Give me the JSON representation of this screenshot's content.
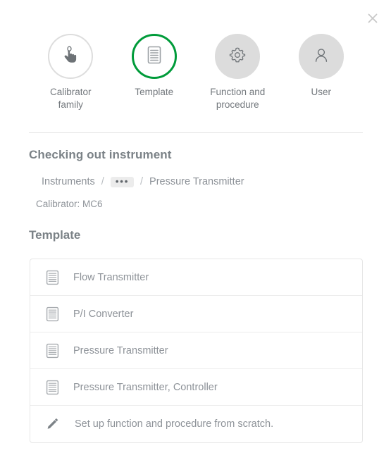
{
  "dialog": {
    "close_label": "×"
  },
  "stepper": {
    "steps": [
      {
        "label": "Calibrator\nfamily",
        "icon": "touch-hand-icon",
        "state": "outline"
      },
      {
        "label": "Template",
        "icon": "document-icon",
        "state": "active"
      },
      {
        "label": "Function and\nprocedure",
        "icon": "gear-icon",
        "state": "filled"
      },
      {
        "label": "User",
        "icon": "user-icon",
        "state": "filled"
      }
    ],
    "active_color": "#009b3a",
    "inactive_fill": "#dcdcdc",
    "outline_color": "#dddddd"
  },
  "checkout": {
    "heading": "Checking out instrument",
    "breadcrumb": {
      "root": "Instruments",
      "separator": "/",
      "ellipsis": "•••",
      "current": "Pressure Transmitter"
    },
    "calibrator_note": "Calibrator: MC6"
  },
  "template_section": {
    "heading": "Template",
    "items": [
      {
        "label": "Flow Transmitter",
        "icon": "document-icon"
      },
      {
        "label": "P/I Converter",
        "icon": "document-icon"
      },
      {
        "label": "Pressure Transmitter",
        "icon": "document-icon"
      },
      {
        "label": "Pressure Transmitter, Controller",
        "icon": "document-icon"
      },
      {
        "label": "Set up function and procedure from scratch.",
        "icon": "pencil-icon"
      }
    ]
  }
}
